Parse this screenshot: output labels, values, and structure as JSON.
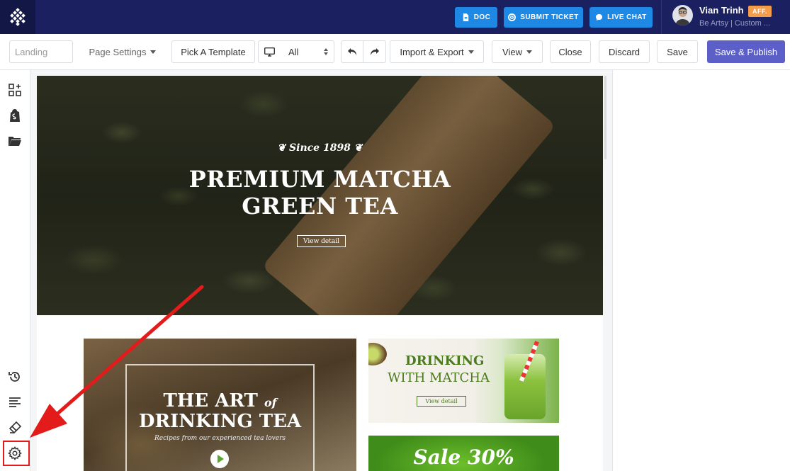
{
  "topbar": {
    "doc_label": "DOC",
    "ticket_label": "SUBMIT TICKET",
    "chat_label": "LIVE CHAT",
    "user_name": "Vian Trinh",
    "user_badge": "AFF.",
    "user_subtitle": "Be Artsy | Custom ...",
    "colors": {
      "bar": "#1b2160",
      "button": "#1e88e5",
      "badge": "#f39c4a"
    }
  },
  "toolbar": {
    "page_name_placeholder": "Landing",
    "page_settings_label": "Page Settings",
    "pick_template_label": "Pick A Template",
    "device_label": "All",
    "import_export_label": "Import & Export",
    "view_label": "View",
    "close_label": "Close",
    "discard_label": "Discard",
    "save_label": "Save",
    "save_publish_label": "Save & Publish",
    "colors": {
      "primary": "#5b5fc7"
    }
  },
  "sidebar": {
    "top_icons": [
      "add-element-icon",
      "shopify-bag-icon",
      "folder-icon"
    ],
    "bottom_icons": [
      "history-icon",
      "outline-icon",
      "eraser-icon",
      "gear-icon"
    ],
    "highlight_color": "#e31b1b"
  },
  "canvas": {
    "hero": {
      "since": "Since 1898",
      "title_line1": "PREMIUM MATCHA",
      "title_line2": "GREEN TEA",
      "button": "View detail"
    },
    "card_art": {
      "line1": "THE ART",
      "line1_of": "of",
      "line2": "DRINKING TEA",
      "subtitle": "Recipes from our experienced tea lovers"
    },
    "card_drink": {
      "line1": "DRINKING",
      "line2": "WITH MATCHA",
      "button": "View detail"
    },
    "card_sale": {
      "text": "Sale 30%"
    }
  }
}
